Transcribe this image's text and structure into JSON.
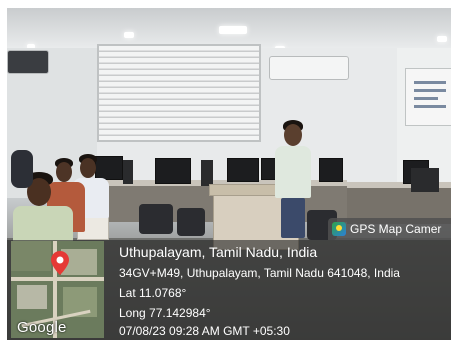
{
  "badge": {
    "label": "GPS Map Camer",
    "icon": "gps-map-camera-icon"
  },
  "location": {
    "title": "Uthupalayam, Tamil Nadu, India",
    "address": "34GV+M49, Uthupalayam, Tamil Nadu 641048, India",
    "lat": "Lat 11.0768°",
    "long": "Long 77.142984°",
    "datetime": "07/08/23 09:28 AM GMT +05:30"
  },
  "map": {
    "logo": "Google",
    "pin_icon": "map-pin-icon",
    "pin_color": "#e53935"
  },
  "colors": {
    "overlay_bg": "#3a3a3a",
    "text": "#ffffff",
    "wall": "#e8eaeb",
    "floor": "#5f605d"
  }
}
